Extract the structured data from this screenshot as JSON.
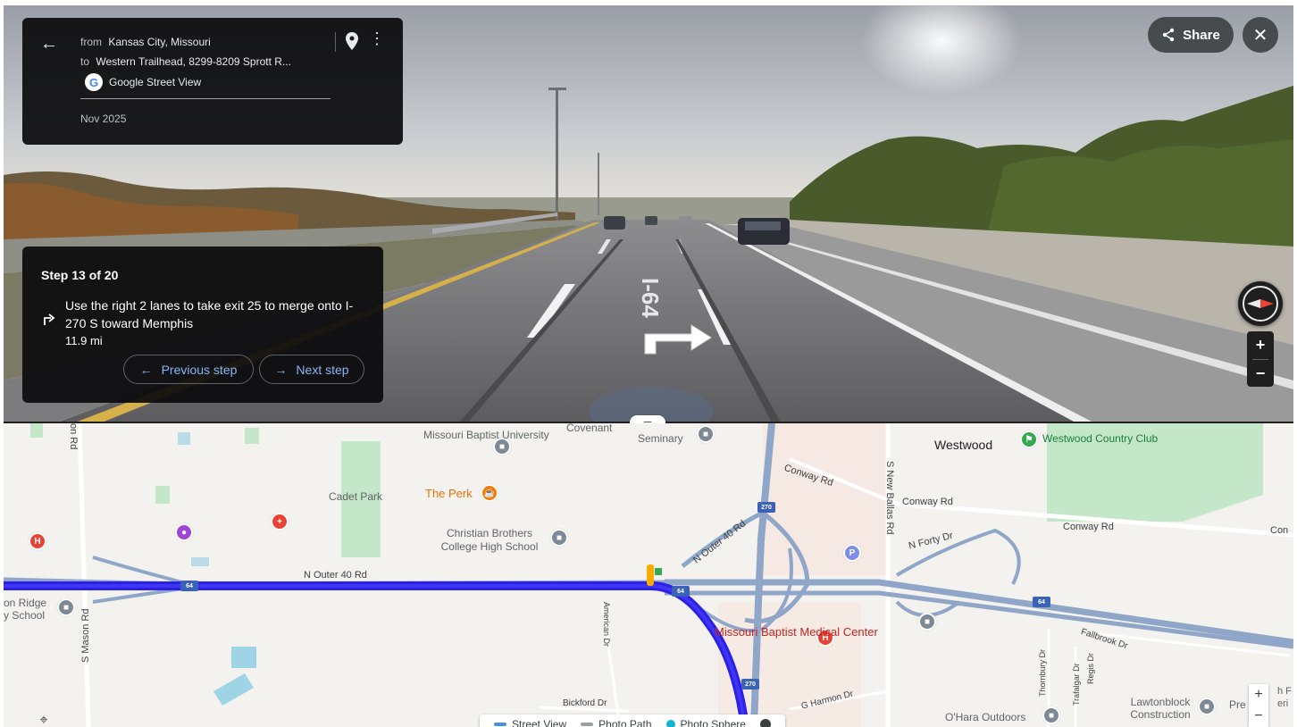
{
  "info": {
    "from_prefix": "from",
    "from": "Kansas City, Missouri",
    "to_prefix": "to",
    "to": "Western Trailhead, 8299-8209 Sprott R...",
    "provider": "Google Street View",
    "date": "Nov 2025"
  },
  "top_buttons": {
    "share": "Share"
  },
  "step": {
    "title": "Step 13 of 20",
    "instruction": "Use the right 2 lanes to take exit 25 to merge onto I-270 S toward Memphis",
    "distance": "11.9 mi",
    "prev": "Previous step",
    "next": "Next step"
  },
  "street_view": {
    "road_marking": "I-64"
  },
  "map": {
    "labels": {
      "missouri_baptist_university": "Missouri Baptist University",
      "covenant_seminary": "Covenant",
      "seminary": "Seminary",
      "westwood": "Westwood",
      "westwood_cc": "Westwood Country Club",
      "cadet_park": "Cadet Park",
      "the_perk": "The Perk",
      "cbc": "Christian Brothers College High School",
      "n_outer_40_rd": "N Outer 40 Rd",
      "n_outer_40_rd_2": "N Outer 40 Rd",
      "conway_rd_1": "Conway Rd",
      "conway_rd_2": "Conway Rd",
      "conway_rd_3": "Conway Rd",
      "conway_cut": "Con",
      "s_new_ballas_rd": "S New Ballas Rd",
      "n_forty_dr": "N Forty Dr",
      "on_ridge": "on Ridge",
      "y_school": "y School",
      "s_mason_rd": "S Mason Rd",
      "rd_top": "on Rd",
      "american_dr": "American Dr",
      "mbmc": "Missouri Baptist Medical Center",
      "bickford_dr": "Bickford Dr",
      "g_harmon_dr": "G Harmon Dr",
      "thornbury_dr": "Thornbury Dr",
      "trafalgar_dr": "Trafalgar Dr",
      "regis_dr": "Regis Dr",
      "fallbrook_dr": "Fallbrook Dr",
      "ohara": "O'Hara Outdoors",
      "lawtonblock": "Lawtonblock Construction",
      "pre_cut": "Pre",
      "edge_cut_1": "h F",
      "edge_cut_2": "eri"
    },
    "shields": {
      "i64_a": "64",
      "i64_b": "64",
      "i64_c": "64",
      "i270_a": "270",
      "i270_b": "270"
    },
    "layers": {
      "street_view": "Street View",
      "photo_path": "Photo Path",
      "photo_sphere": "Photo Sphere"
    },
    "colors": {
      "route": "#2c1fe6",
      "highway": "#8fa6c8",
      "park": "#c4e6c9"
    }
  }
}
